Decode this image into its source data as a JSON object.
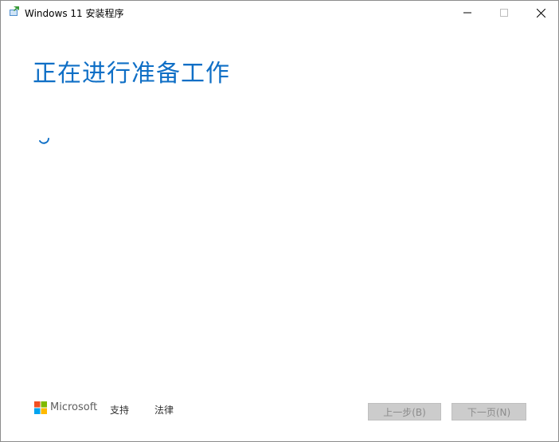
{
  "window": {
    "title": "Windows 11 安装程序",
    "controls": {
      "minimize_icon": "minimize-icon",
      "maximize_icon": "maximize-icon",
      "close_icon": "close-icon"
    }
  },
  "main": {
    "heading": "正在进行准备工作",
    "status": "loading"
  },
  "footer": {
    "brand": "Microsoft",
    "links": {
      "support": "支持",
      "legal": "法律"
    },
    "buttons": {
      "back": "上一步(B)",
      "next": "下一页(N)"
    }
  },
  "colors": {
    "accent": "#0f6fc6",
    "disabled_button_bg": "#cccccc",
    "disabled_button_text": "#8c8c8c",
    "logo_red": "#f25022",
    "logo_green": "#7fba00",
    "logo_blue": "#00a4ef",
    "logo_yellow": "#ffb900"
  }
}
